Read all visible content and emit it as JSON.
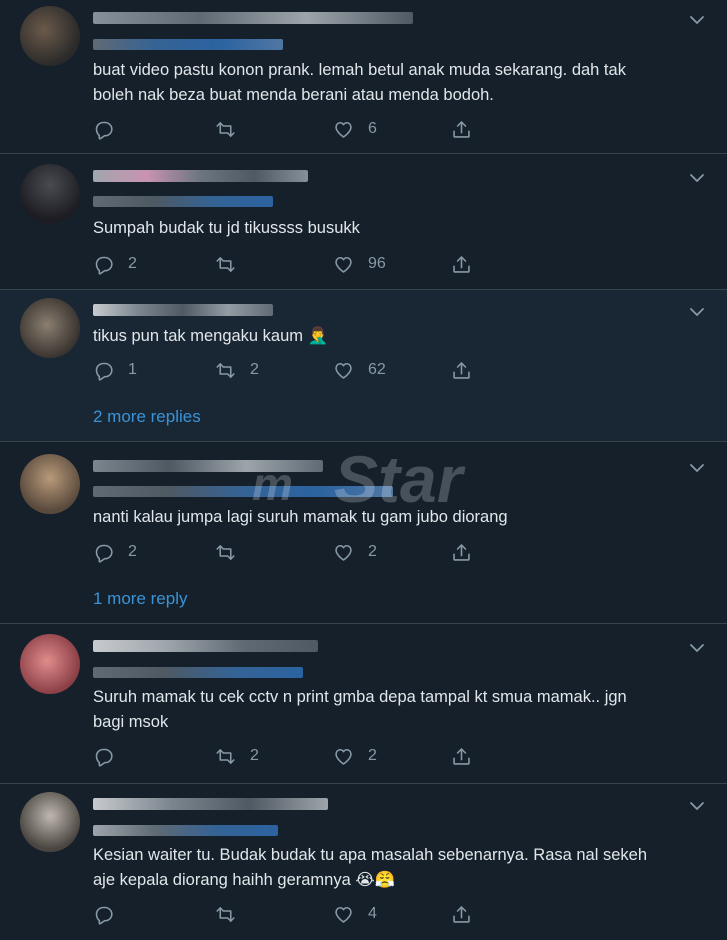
{
  "colors": {
    "background": "#15202b",
    "highlight_background": "#192734",
    "divider": "#38444d",
    "text": "#e1e6ea",
    "muted": "#8899a6",
    "link": "#3a93d8"
  },
  "watermark": {
    "prefix": "m",
    "label": "Star"
  },
  "icons": [
    "reply-icon",
    "retweet-icon",
    "like-icon",
    "share-icon",
    "chevron-down-icon"
  ],
  "tweets": [
    {
      "line1": "buat video pastu konon prank. lemah betul anak muda sekarang. dah tak",
      "line2": "boleh nak beza buat menda berani atau menda bodoh.",
      "replies": "",
      "retweets": "",
      "likes": "6"
    },
    {
      "line1": "Sumpah budak tu jd tikussss busukk",
      "line2": "",
      "replies": "2",
      "retweets": "",
      "likes": "96"
    },
    {
      "line1": "tikus pun tak mengaku kaum 🤦‍♂️",
      "line2": "",
      "replies": "1",
      "retweets": "2",
      "likes": "62",
      "more_replies": "2 more replies"
    },
    {
      "line1": "nanti kalau jumpa lagi suruh mamak tu gam jubo diorang",
      "line2": "",
      "replies": "2",
      "retweets": "",
      "likes": "2",
      "more_replies": "1 more reply"
    },
    {
      "line1": "Suruh mamak tu cek cctv n print gmba depa tampal kt smua mamak.. jgn",
      "line2": "bagi msok",
      "replies": "",
      "retweets": "2",
      "likes": "2"
    },
    {
      "line1": "Kesian waiter tu. Budak budak tu apa masalah sebenarnya. Rasa nal sekeh",
      "line2": "aje kepala diorang haihh geramnya 😭😤",
      "replies": "",
      "retweets": "",
      "likes": "4"
    }
  ]
}
